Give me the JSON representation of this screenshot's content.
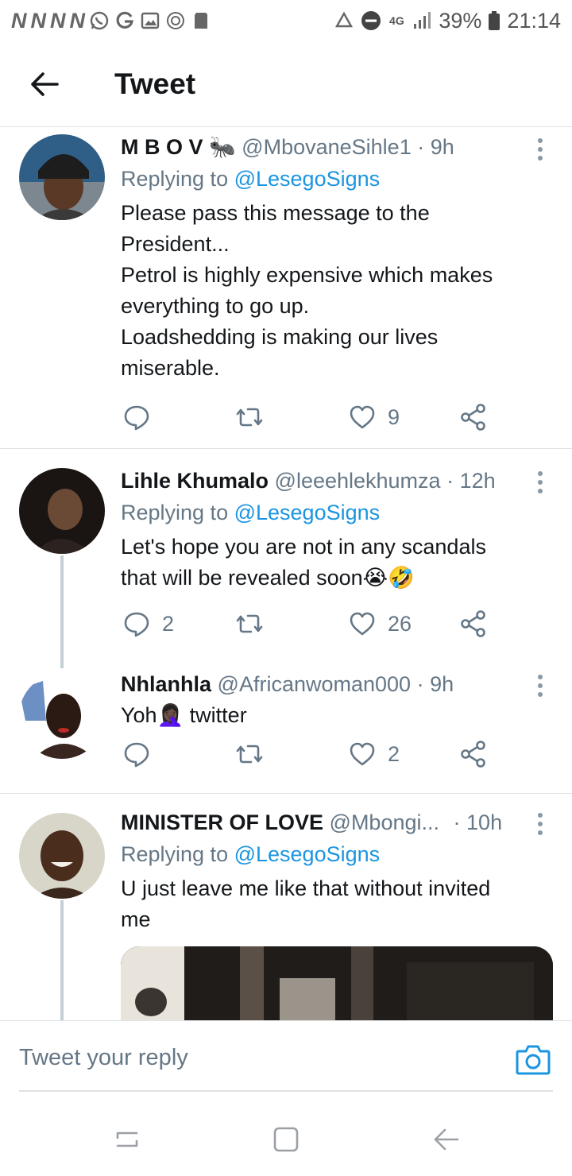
{
  "status_bar": {
    "left_notifications": [
      "N",
      "N",
      "N",
      "N"
    ],
    "left_icons": [
      "whatsapp-icon",
      "google-icon",
      "gallery-icon",
      "radio-icon",
      "sd-card-icon"
    ],
    "network": "4G",
    "battery": "39%",
    "time": "21:14"
  },
  "app_bar": {
    "title": "Tweet"
  },
  "tweets": [
    {
      "name": "M B O V",
      "name_emoji": "🐜",
      "handle": "@MbovaneSihle1",
      "dot": "·",
      "time": "9h",
      "replying_prefix": "Replying to ",
      "replying_to": "@LesegoSigns",
      "body": [
        "Please pass this message to the",
        "President...",
        "Petrol is highly expensive which makes",
        "everything to go up.",
        "Loadshedding is making our lives",
        "miserable."
      ],
      "replies": "",
      "retweets": "",
      "likes": "9"
    },
    {
      "name": "Lihle Khumalo",
      "handle": "@leeehlekhumza",
      "dot": "·",
      "time": "12h",
      "replying_prefix": "Replying to ",
      "replying_to": "@LesegoSigns",
      "body": [
        "Let's hope you are not in any scandals",
        "that will be revealed soon😭🤣"
      ],
      "replies": "2",
      "retweets": "",
      "likes": "26"
    },
    {
      "name": "Nhlanhla",
      "handle": "@Africanwoman000",
      "dot": "·",
      "time": "9h",
      "body": [
        "Yoh🤦🏿‍♀️ twitter"
      ],
      "replies": "",
      "retweets": "",
      "likes": "2"
    },
    {
      "name": "MINISTER OF LOVE",
      "handle": "@Mbongi...",
      "dot": "·",
      "time": "10h",
      "replying_prefix": "Replying to ",
      "replying_to": "@LesegoSigns",
      "body": [
        "U just leave me like that without invited",
        "me"
      ]
    }
  ],
  "compose": {
    "placeholder": "Tweet your reply"
  },
  "colors": {
    "link_blue": "#1b95e0",
    "secondary_text": "#657786",
    "primary_text": "#14171a",
    "divider": "#dfe3e6"
  }
}
